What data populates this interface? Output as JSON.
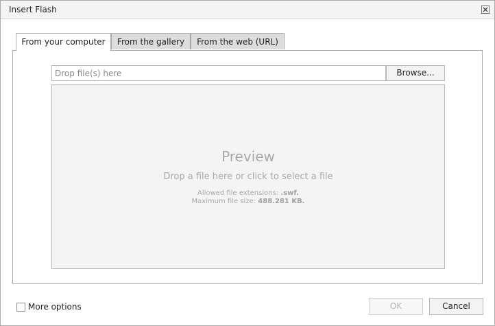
{
  "window": {
    "title": "Insert Flash",
    "close_icon": "close-icon"
  },
  "tabs": [
    {
      "label": "From your computer",
      "active": true
    },
    {
      "label": "From the gallery",
      "active": false
    },
    {
      "label": "From the web (URL)",
      "active": false
    }
  ],
  "upload": {
    "placeholder": "Drop file(s) here",
    "value": "",
    "browse_label": "Browse..."
  },
  "preview": {
    "title": "Preview",
    "subtitle": "Drop a file here or click to select a file",
    "extensions_label": "Allowed file extensions:",
    "extensions_value": ".swf.",
    "size_label": "Maximum file size:",
    "size_value": "488.281 KB."
  },
  "footer": {
    "more_options_label": "More options",
    "more_options_checked": false,
    "ok_label": "OK",
    "ok_enabled": false,
    "cancel_label": "Cancel"
  },
  "colors": {
    "preview_background": "#f4f4f4",
    "preview_text": "#a8a8a8",
    "inactive_tab": "#dcdcdc",
    "border": "#a9a9a9"
  }
}
